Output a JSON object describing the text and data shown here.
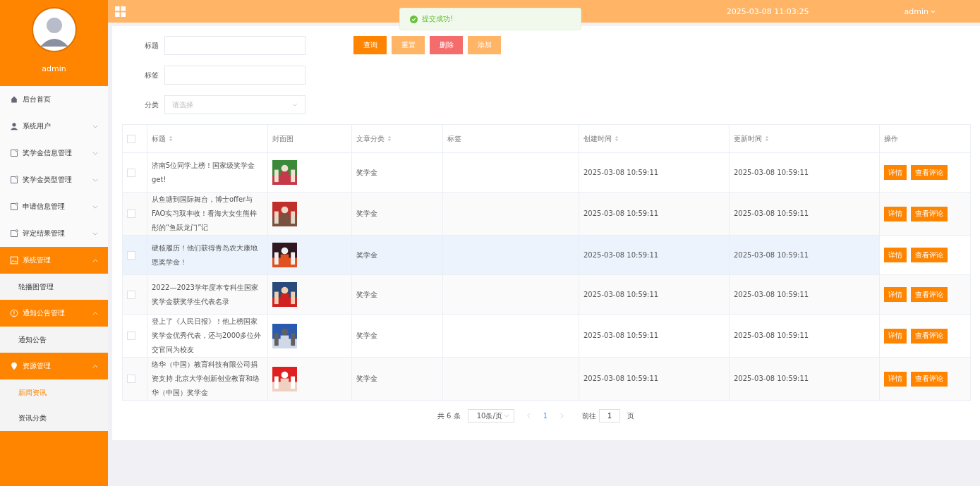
{
  "sidebar": {
    "user": "admin",
    "items": [
      {
        "label": "后台首页",
        "expandable": false,
        "expanded": false
      },
      {
        "label": "系统用户",
        "expandable": true,
        "expanded": false
      },
      {
        "label": "奖学金信息管理",
        "expandable": true,
        "expanded": false
      },
      {
        "label": "奖学金类型管理",
        "expandable": true,
        "expanded": false
      },
      {
        "label": "申请信息管理",
        "expandable": true,
        "expanded": false
      },
      {
        "label": "评定结果管理",
        "expandable": true,
        "expanded": false
      },
      {
        "label": "系统管理",
        "expandable": true,
        "expanded": true,
        "children": [
          {
            "label": "轮播图管理",
            "selected": false
          }
        ]
      },
      {
        "label": "通知公告管理",
        "expandable": true,
        "expanded": true,
        "children": [
          {
            "label": "通知公告",
            "selected": false
          }
        ]
      },
      {
        "label": "资源管理",
        "expandable": true,
        "expanded": true,
        "children": [
          {
            "label": "新闻资讯",
            "selected": true
          },
          {
            "label": "资讯分类",
            "selected": false
          }
        ]
      }
    ]
  },
  "header": {
    "datetime": "2025-03-08 11:03:25",
    "user": "admin"
  },
  "toast": {
    "message": "提交成功!"
  },
  "filters": [
    {
      "label": "标题",
      "kind": "text"
    },
    {
      "label": "标签",
      "kind": "text"
    },
    {
      "label": "分类",
      "kind": "select",
      "placeholder": "请选择"
    }
  ],
  "actions": [
    {
      "label": "查询",
      "kind": "primary"
    },
    {
      "label": "重置",
      "kind": "light"
    },
    {
      "label": "删除",
      "kind": "danger"
    },
    {
      "label": "添加",
      "kind": "light"
    }
  ],
  "table": {
    "all_checked": false,
    "columns": [
      {
        "label": "标题",
        "sortable": true
      },
      {
        "label": "封面图",
        "sortable": false
      },
      {
        "label": "文章分类",
        "sortable": true
      },
      {
        "label": "标签",
        "sortable": false
      },
      {
        "label": "创建时间",
        "sortable": true
      },
      {
        "label": "更新时间",
        "sortable": true
      },
      {
        "label": "操作",
        "sortable": false
      }
    ],
    "rows": [
      {
        "title": "济南5位同学上榜！国家级奖学金get!",
        "category": "奖学金",
        "created": "2025-03-08 10:59:11",
        "updated": "2025-03-08 10:59:11",
        "hovered": false,
        "checked": false,
        "buttons": [
          "详情",
          "查看评论"
        ]
      },
      {
        "title": "从鱼塘到国际舞台，博士offer与FAO实习双丰收！看海大女生熊梓彤的“鱼跃龙门”记",
        "category": "奖学金",
        "created": "2025-03-08 10:59:11",
        "updated": "2025-03-08 10:59:11",
        "hovered": false,
        "checked": false,
        "buttons": [
          "详情",
          "查看评论"
        ]
      },
      {
        "title": "硬核履历！他们获得青岛农大康地恩奖学金！",
        "category": "奖学金",
        "created": "2025-03-08 10:59:11",
        "updated": "2025-03-08 10:59:11",
        "hovered": true,
        "checked": false,
        "buttons": [
          "详情",
          "查看评论"
        ]
      },
      {
        "title": "2022—2023学年度本专科生国家奖学金获奖学生代表名录",
        "category": "奖学金",
        "created": "2025-03-08 10:59:11",
        "updated": "2025-03-08 10:59:11",
        "hovered": false,
        "checked": false,
        "buttons": [
          "详情",
          "查看评论"
        ]
      },
      {
        "title": "登上了《人民日报》！他上榜国家奖学金优秀代表，还与2000多位外交官同为校友",
        "category": "奖学金",
        "created": "2025-03-08 10:59:11",
        "updated": "2025-03-08 10:59:11",
        "hovered": false,
        "checked": false,
        "buttons": [
          "详情",
          "查看评论"
        ]
      },
      {
        "title": "络华（中国）教育科技有限公司捐资支持 北京大学创新创业教育和络华（中国）奖学金",
        "category": "奖学金",
        "created": "2025-03-08 10:59:11",
        "updated": "2025-03-08 10:59:11",
        "hovered": false,
        "checked": false,
        "buttons": [
          "详情",
          "查看评论"
        ]
      }
    ]
  },
  "pagination": {
    "total": "共 6 条",
    "page_size": "10条/页",
    "pages": [
      {
        "label": "1",
        "selected": true
      }
    ],
    "goto_label": "前往",
    "goto_value": "1",
    "page_unit": "页"
  }
}
